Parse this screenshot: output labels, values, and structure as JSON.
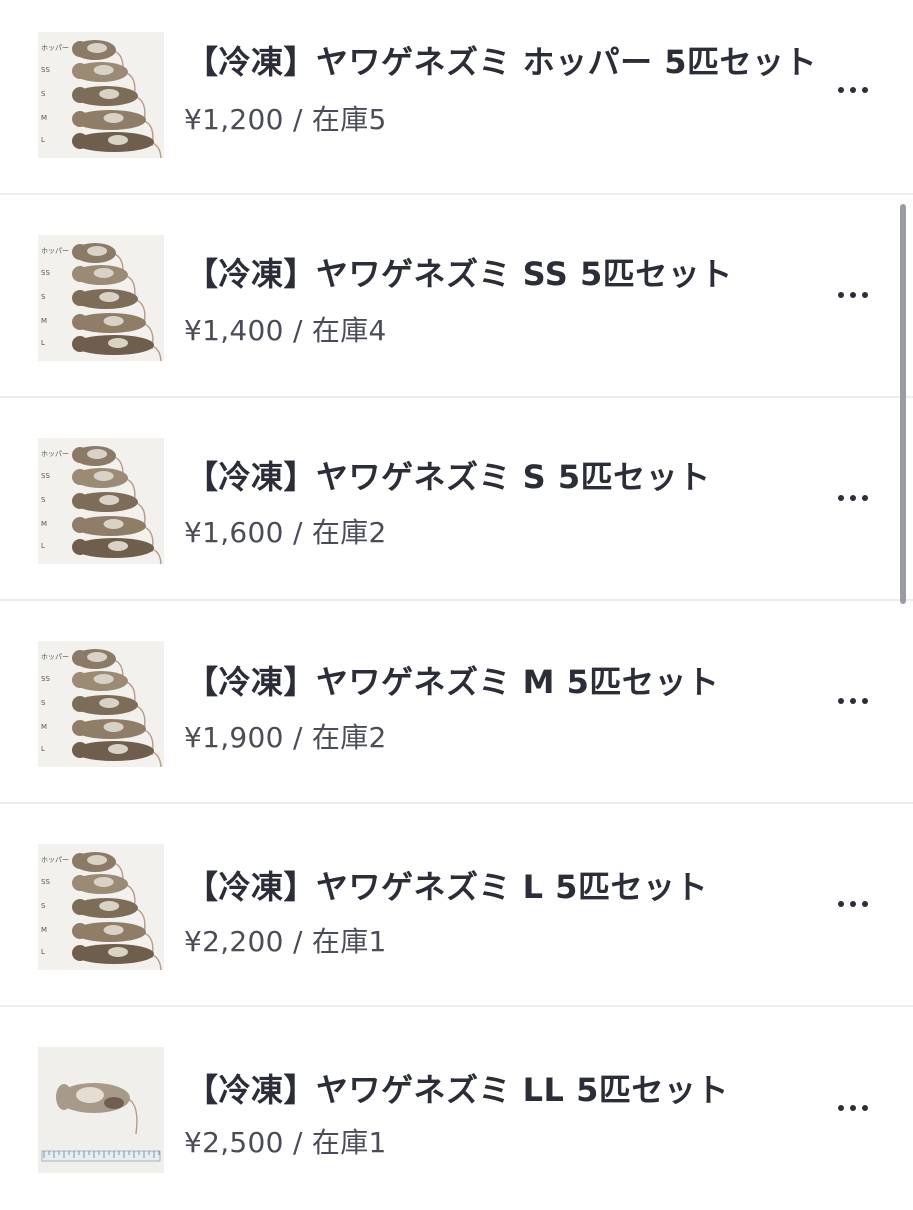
{
  "products": [
    {
      "title": "【冷凍】ヤワゲネズミ ホッパー 5匹セット",
      "meta": "¥1,200 / 在庫5",
      "price": "¥1,200",
      "stock": "在庫5",
      "image": "mice-size-chart"
    },
    {
      "title": "【冷凍】ヤワゲネズミ SS 5匹セット",
      "meta": "¥1,400 / 在庫4",
      "price": "¥1,400",
      "stock": "在庫4",
      "image": "mice-size-chart"
    },
    {
      "title": "【冷凍】ヤワゲネズミ S 5匹セット",
      "meta": "¥1,600 / 在庫2",
      "price": "¥1,600",
      "stock": "在庫2",
      "image": "mice-size-chart"
    },
    {
      "title": "【冷凍】ヤワゲネズミ M 5匹セット",
      "meta": "¥1,900 / 在庫2",
      "price": "¥1,900",
      "stock": "在庫2",
      "image": "mice-size-chart"
    },
    {
      "title": "【冷凍】ヤワゲネズミ L 5匹セット",
      "meta": "¥2,200 / 在庫1",
      "price": "¥2,200",
      "stock": "在庫1",
      "image": "mice-size-chart"
    },
    {
      "title": "【冷凍】ヤワゲネズミ LL 5匹セット",
      "meta": "¥2,500 / 在庫1",
      "price": "¥2,500",
      "stock": "在庫1",
      "image": "single-mouse-ruler"
    }
  ],
  "thumb_labels": [
    "ホッパー",
    "SS",
    "S",
    "M",
    "L"
  ],
  "more_icon": "ellipsis-icon",
  "colors": {
    "text": "#2b2e38",
    "subtext": "#4a4d57",
    "divider": "#ececef",
    "scrollbar": "#9a9ca3"
  }
}
